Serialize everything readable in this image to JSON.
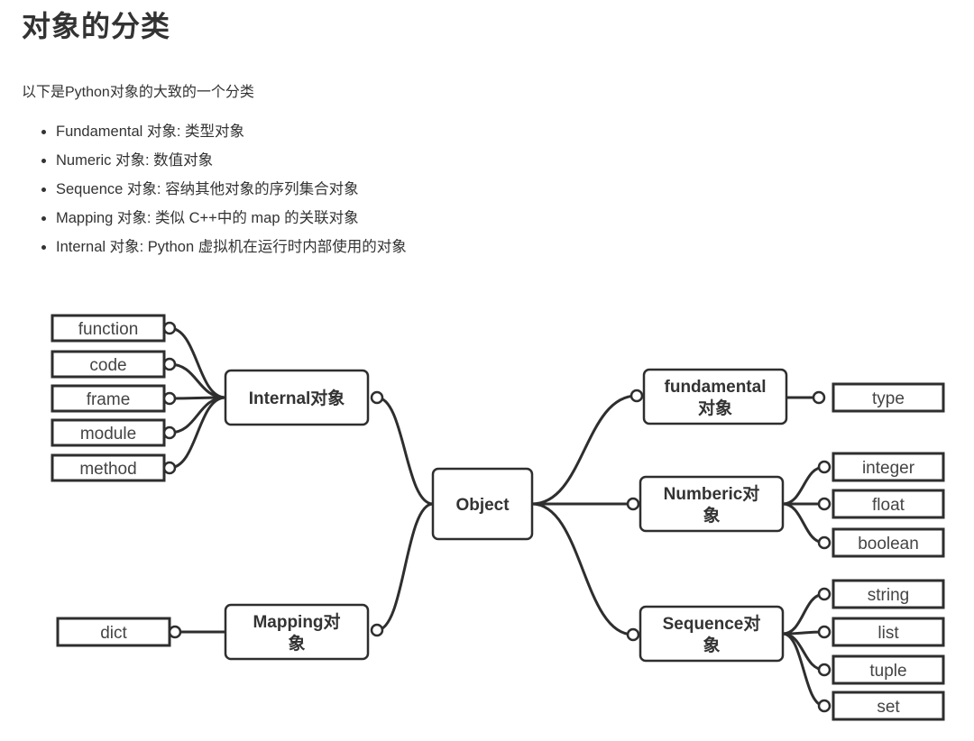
{
  "page": {
    "title": "对象的分类",
    "intro": "以下是Python对象的大致的一个分类",
    "bullets": [
      "Fundamental 对象: 类型对象",
      "Numeric 对象: 数值对象",
      "Sequence 对象: 容纳其他对象的序列集合对象",
      "Mapping 对象: 类似 C++中的 map 的关联对象",
      "Internal 对象: Python 虚拟机在运行时内部使用的对象"
    ]
  },
  "diagram": {
    "root": "Object",
    "groups": {
      "internal": {
        "label": [
          "Internal对象"
        ],
        "children": [
          "function",
          "code",
          "frame",
          "module",
          "method"
        ]
      },
      "mapping": {
        "label": [
          "Mapping对",
          "象"
        ],
        "children": [
          "dict"
        ]
      },
      "fundamental": {
        "label": [
          "fundamental",
          "对象"
        ],
        "children": [
          "type"
        ]
      },
      "numeric": {
        "label": [
          "Numberic对",
          "象"
        ],
        "children": [
          "integer",
          "float",
          "boolean"
        ]
      },
      "sequence": {
        "label": [
          "Sequence对",
          "象"
        ],
        "children": [
          "string",
          "list",
          "tuple",
          "set"
        ]
      }
    }
  }
}
